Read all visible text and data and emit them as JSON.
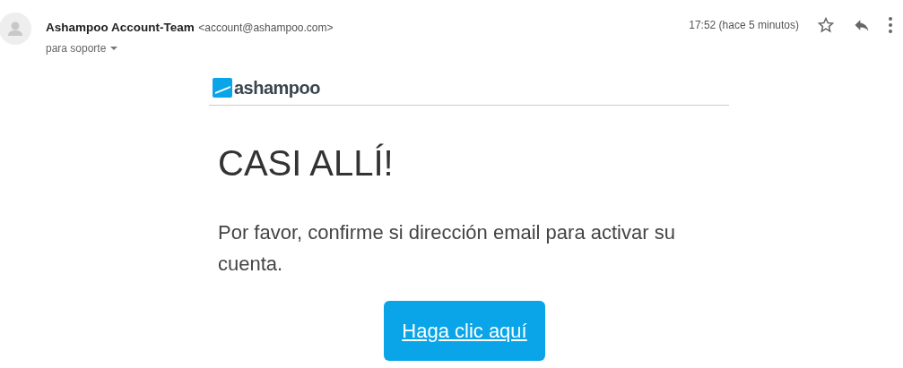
{
  "sender": {
    "name": "Ashampoo Account-Team",
    "address": "<account@ashampoo.com>",
    "recipient": "para soporte"
  },
  "time": "17:52 (hace 5 minutos)",
  "email": {
    "logo": "ashampoo",
    "heading": "CASI ALLÍ!",
    "message": "Por favor, confirme si dirección email para activar su cuenta.",
    "button": "Haga clic aquí"
  }
}
